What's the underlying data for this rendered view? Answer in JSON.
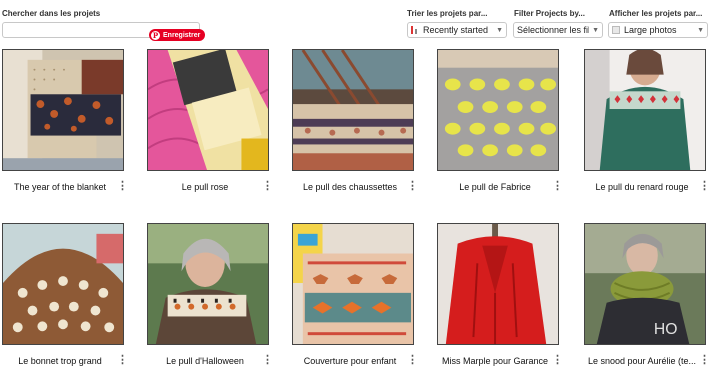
{
  "search": {
    "label": "Chercher dans les projets",
    "value": "",
    "placeholder": ""
  },
  "pinterest_button": {
    "label": "Enregistrer",
    "icon": "P"
  },
  "sort": {
    "label": "Trier les projets par...",
    "selected": "Recently started"
  },
  "filter": {
    "label": "Filter Projects by...",
    "selected": "Sélectionner les filtr"
  },
  "display": {
    "label": "Afficher les projets par...",
    "selected": "Large photos"
  },
  "projects": [
    {
      "title": "The year of the blanket",
      "menu_icon": "⋮"
    },
    {
      "title": "Le pull rose",
      "menu_icon": "⋮"
    },
    {
      "title": "Le pull des chaussettes",
      "menu_icon": "⋮"
    },
    {
      "title": "Le pull de Fabrice",
      "menu_icon": "⋮"
    },
    {
      "title": "Le pull du renard rouge",
      "menu_icon": "⋮"
    },
    {
      "title": "Le bonnet trop grand",
      "menu_icon": "⋮"
    },
    {
      "title": "Le pull d'Halloween",
      "menu_icon": "⋮"
    },
    {
      "title": "Couverture pour enfant",
      "menu_icon": "⋮"
    },
    {
      "title": "Miss Marple pour Garance",
      "menu_icon": "⋮"
    },
    {
      "title": "Le snood pour Aurélie (te...",
      "menu_icon": "⋮"
    }
  ],
  "colors": {
    "pinterest_red": "#e60023",
    "kebab": "#555555"
  }
}
